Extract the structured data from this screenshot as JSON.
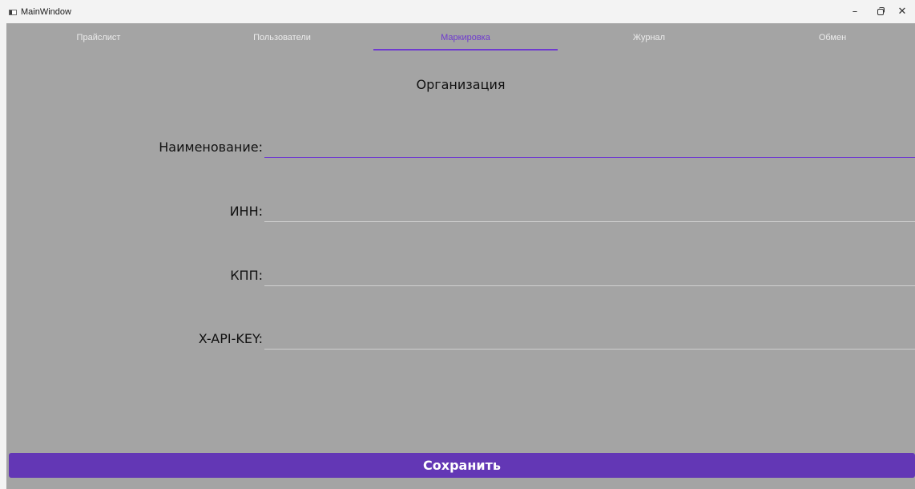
{
  "window": {
    "title": "MainWindow",
    "controls": {
      "minimize": "–",
      "close": "✕"
    }
  },
  "tabs": [
    {
      "label": "Прайслист",
      "active": false
    },
    {
      "label": "Пользователи",
      "active": false
    },
    {
      "label": "Маркировка",
      "active": true
    },
    {
      "label": "Журнал",
      "active": false
    },
    {
      "label": "Обмен",
      "active": false
    }
  ],
  "form": {
    "title": "Организация",
    "fields": [
      {
        "label": "Наименование:",
        "value": ""
      },
      {
        "label": "ИНН:",
        "value": ""
      },
      {
        "label": "КПП:",
        "value": ""
      },
      {
        "label": "X-API-KEY:",
        "value": ""
      }
    ]
  },
  "actions": {
    "save_label": "Сохранить"
  },
  "colors": {
    "accent": "#6f3bcf",
    "button": "#6337b5",
    "content_bg": "#a4a4a4",
    "titlebar_bg": "#f3f3f3"
  }
}
